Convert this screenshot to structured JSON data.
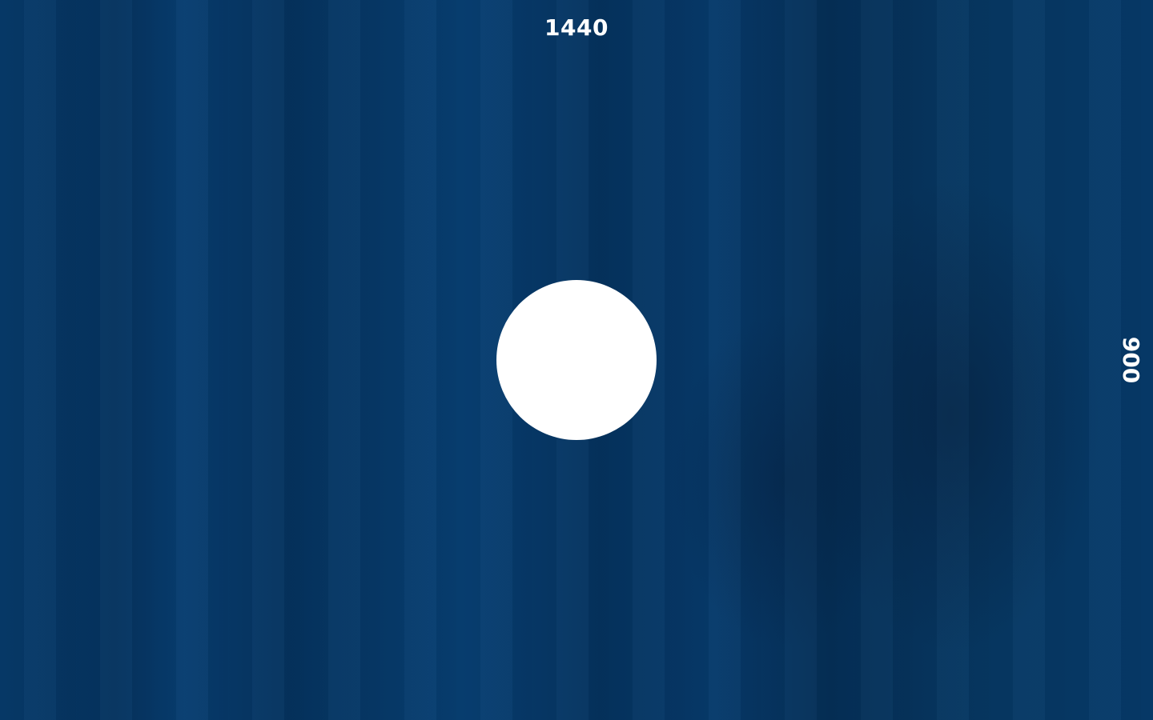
{
  "placeholder": {
    "width_label": "1440",
    "height_label": "900",
    "background_color": "#063a6a",
    "circle_color": "#ffffff"
  }
}
